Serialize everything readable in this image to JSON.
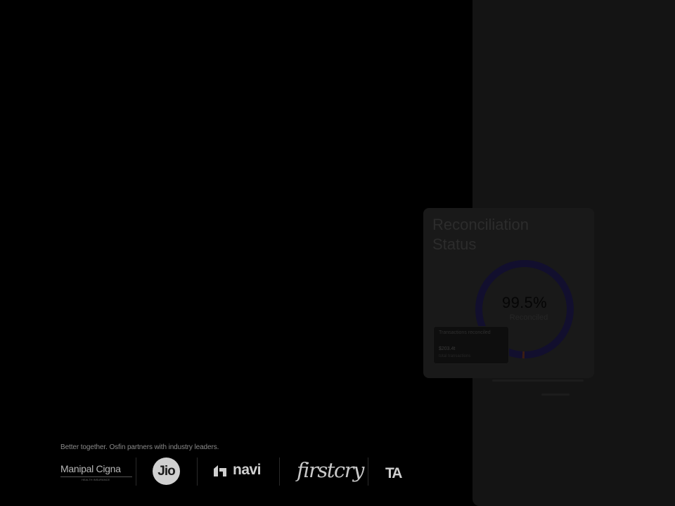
{
  "reconciliation_card": {
    "title": "Reconciliation Status",
    "percent": "99.5%",
    "percent_label": "Reconciled",
    "tooltip": {
      "title": "Transactions reconciled",
      "value": "$203.4t",
      "sub": "total transactions"
    }
  },
  "partners": {
    "caption": "Better together. Osfin partners with industry leaders.",
    "logos": {
      "manipal_cigna": "Manipal Cigna",
      "manipal_sub": "HEALTH INSURANCE",
      "jio": "Jio",
      "navi": "navi",
      "firstcry": "firstcry",
      "ta": "TA"
    }
  },
  "colors": {
    "page_bg": "#000000",
    "right_panel_bg": "#141414",
    "card_bg": "#191919",
    "donut_ring": "#120f2e",
    "donut_accent": "#3a1d12"
  },
  "icons": [
    "navi-logo-mark-icon"
  ]
}
